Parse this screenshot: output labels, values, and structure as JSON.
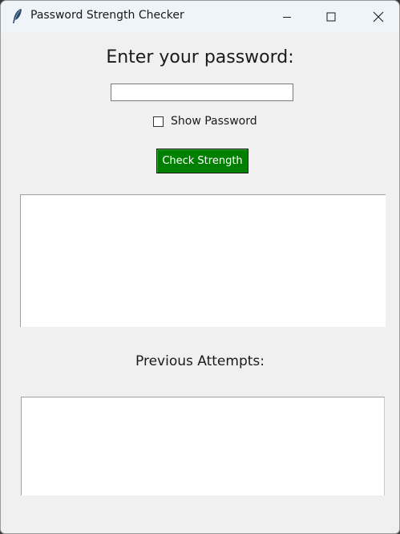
{
  "window": {
    "title": "Password Strength Checker",
    "icon": "feather-icon"
  },
  "main": {
    "heading": "Enter your password:",
    "password_value": "",
    "show_password_label": "Show Password",
    "show_password_checked": false,
    "check_button_label": "Check Strength",
    "result_text": "",
    "previous_heading": "Previous Attempts:",
    "previous_attempts": []
  },
  "colors": {
    "button_bg": "#008000",
    "button_text": "#ffffff",
    "window_bg": "#f0f0f0"
  }
}
